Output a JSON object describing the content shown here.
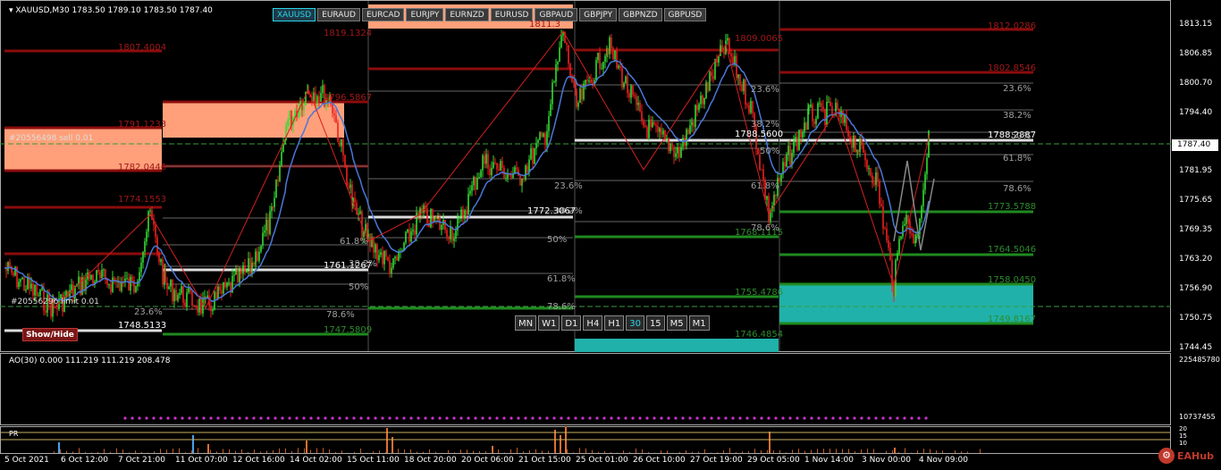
{
  "header": {
    "symbol_line": "▾ XAUUSD,M30  1783.50 1789.10 1783.50 1787.40"
  },
  "pair_tabs": [
    {
      "label": "XAUUSD",
      "active": true
    },
    {
      "label": "EURAUD",
      "active": false
    },
    {
      "label": "EURCAD",
      "active": false
    },
    {
      "label": "EURJPY",
      "active": false
    },
    {
      "label": "EURNZD",
      "active": false
    },
    {
      "label": "EURUSD",
      "active": false
    },
    {
      "label": "GBPAUD",
      "active": false
    },
    {
      "label": "GBPJPY",
      "active": false
    },
    {
      "label": "GBPNZD",
      "active": false
    },
    {
      "label": "GBPUSD",
      "active": false
    }
  ],
  "timeframes": [
    {
      "label": "MN",
      "active": false
    },
    {
      "label": "W1",
      "active": false
    },
    {
      "label": "D1",
      "active": false
    },
    {
      "label": "H4",
      "active": false
    },
    {
      "label": "H1",
      "active": false
    },
    {
      "label": "30",
      "active": true
    },
    {
      "label": "15",
      "active": false
    },
    {
      "label": "M5",
      "active": false
    },
    {
      "label": "M1",
      "active": false
    }
  ],
  "show_hide_label": "Show/Hide",
  "order_labels": {
    "sell_order": "#20556498 sell 0.01",
    "limit_order": "#20556296 limit 0.01"
  },
  "indicator": {
    "ao_title": "AO(30) 0.000 111.219 111.219 208.478",
    "pr_title": "PR"
  },
  "price_axis": {
    "labels": [
      "1813.15",
      "1806.85",
      "1800.70",
      "1794.40",
      "1787.40",
      "1781.95",
      "1775.65",
      "1769.35",
      "1763.20",
      "1756.90",
      "1750.75",
      "1744.45"
    ],
    "current": "1787.40",
    "ind_labels": [
      "225485780",
      "10737455",
      "20",
      "15",
      "10"
    ]
  },
  "time_axis": {
    "labels": [
      "5 Oct 2021",
      "6 Oct 12:00",
      "7 Oct 21:00",
      "11 Oct 07:00",
      "12 Oct 16:00",
      "14 Oct 02:00",
      "15 Oct 11:00",
      "18 Oct 20:00",
      "20 Oct 06:00",
      "21 Oct 15:00",
      "25 Oct 01:00",
      "26 Oct 10:00",
      "27 Oct 19:00",
      "29 Oct 05:00",
      "1 Nov 14:00",
      "3 Nov 00:00",
      "4 Nov 09:00"
    ]
  },
  "levels": [
    {
      "text": "1807.4004",
      "color": "#a01818"
    },
    {
      "text": "1791.1233",
      "color": "#a01818"
    },
    {
      "text": "1782.0446",
      "color": "#a01818"
    },
    {
      "text": "1774.1553",
      "color": "#a01818"
    },
    {
      "text": "1748.5133",
      "color": "#ffffff"
    },
    {
      "text": "1819.1324",
      "color": "#a01818"
    },
    {
      "text": "1796.5867",
      "color": "#a01818"
    },
    {
      "text": "1761.1267",
      "color": "#ffffff"
    },
    {
      "text": "1747.5809",
      "color": "#2e8b2e"
    },
    {
      "text": "1811.3",
      "color": "#a01818"
    },
    {
      "text": "1772.3067",
      "color": "#ffffff"
    },
    {
      "text": "1809.0065",
      "color": "#a01818"
    },
    {
      "text": "1788.5600",
      "color": "#ffffff"
    },
    {
      "text": "1768.1115",
      "color": "#2e8b2e"
    },
    {
      "text": "1755.4786",
      "color": "#2e8b2e"
    },
    {
      "text": "1746.4854",
      "color": "#2e8b2e"
    },
    {
      "text": "1812.0286",
      "color": "#a01818"
    },
    {
      "text": "1802.8546",
      "color": "#a01818"
    },
    {
      "text": "1788.2887",
      "color": "#ffffff"
    },
    {
      "text": "1773.5788",
      "color": "#2e8b2e"
    },
    {
      "text": "1764.5046",
      "color": "#2e8b2e"
    },
    {
      "text": "1758.0450",
      "color": "#2e8b2e"
    },
    {
      "text": "1749.8167",
      "color": "#2e8b2e"
    }
  ],
  "fib_labels": [
    "23.6%",
    "38.2%",
    "50%",
    "61.8%",
    "78.6%",
    "23.6%",
    "38.2%",
    "50%",
    "61.8%",
    "78.6%",
    "23.6%",
    "38.2%",
    "50%",
    "61.8%",
    "78.6%"
  ],
  "logo_text": "EAHub",
  "colors": {
    "bull": "#33dd33",
    "bear": "#ee2020",
    "ma": "#4a78d8",
    "zone_sell": "#ffa07a",
    "zone_buy": "#20b2aa",
    "level_red": "#8b0d0d",
    "level_green": "#1f8a1f",
    "ao_marker": "#cc33cc"
  }
}
